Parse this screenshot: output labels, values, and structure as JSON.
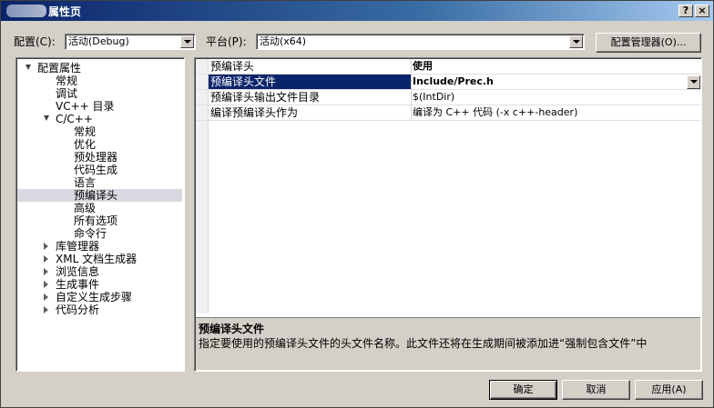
{
  "window": {
    "title": "属性页",
    "help_glyph": "?",
    "close_glyph": "×"
  },
  "config": {
    "config_label": "配置(C):",
    "config_value": "活动(Debug)",
    "platform_label": "平台(P):",
    "platform_value": "活动(x64)",
    "manager_button": "配置管理器(O)..."
  },
  "tree": {
    "items": [
      {
        "label": "配置属性",
        "expander": "open"
      },
      {
        "label": "常规"
      },
      {
        "label": "调试"
      },
      {
        "label": "VC++ 目录"
      },
      {
        "label": "C/C++",
        "expander": "open"
      },
      {
        "label": "常规"
      },
      {
        "label": "优化"
      },
      {
        "label": "预处理器"
      },
      {
        "label": "代码生成"
      },
      {
        "label": "语言"
      },
      {
        "label": "预编译头",
        "selected": true
      },
      {
        "label": "高级"
      },
      {
        "label": "所有选项"
      },
      {
        "label": "命令行"
      },
      {
        "label": "库管理器",
        "expander": "closed"
      },
      {
        "label": "XML 文档生成器",
        "expander": "closed"
      },
      {
        "label": "浏览信息",
        "expander": "closed"
      },
      {
        "label": "生成事件",
        "expander": "closed"
      },
      {
        "label": "自定义生成步骤",
        "expander": "closed"
      },
      {
        "label": "代码分析",
        "expander": "closed"
      }
    ]
  },
  "grid": {
    "rows": [
      {
        "name": "预编译头",
        "value": "使用",
        "bold": true
      },
      {
        "name": "预编译头文件",
        "value": "Include/Prec.h",
        "bold": true,
        "selected": true
      },
      {
        "name": "预编译头输出文件目录",
        "value": "$(IntDir)"
      },
      {
        "name": "编译预编译头作为",
        "value": "编译为 C++ 代码 (-x c++-header)"
      }
    ]
  },
  "description": {
    "title": "预编译头文件",
    "text": "指定要使用的预编译头文件的头文件名称。此文件还将在生成期间被添加进“强制包含文件”中"
  },
  "buttons": {
    "ok": "确定",
    "cancel": "取消",
    "apply": "应用(A)"
  }
}
